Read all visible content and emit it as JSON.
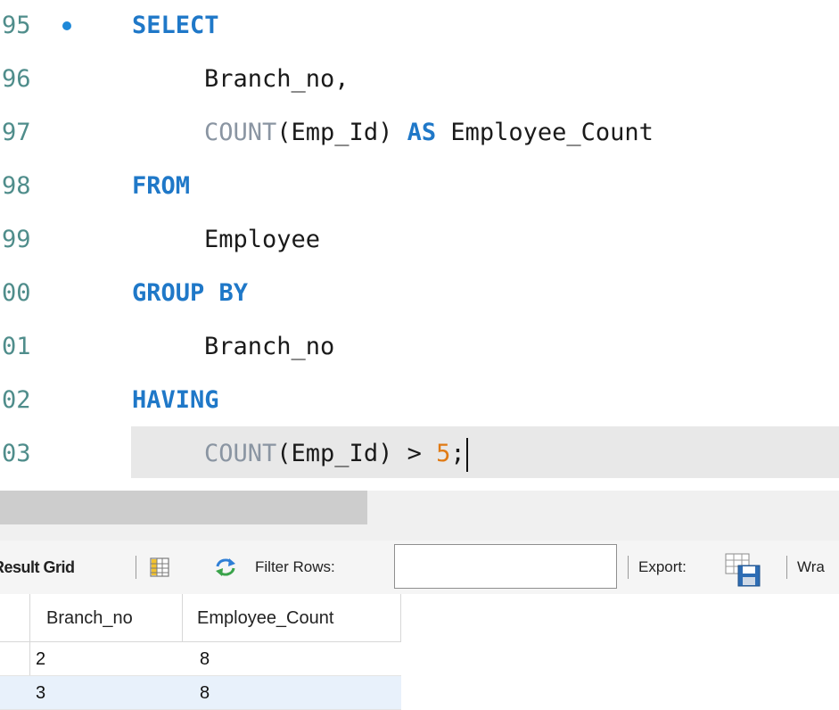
{
  "editor": {
    "lines": [
      {
        "ln": "95",
        "marker": true,
        "tokens": [
          {
            "t": "kw",
            "v": "SELECT"
          }
        ]
      },
      {
        "ln": "96",
        "marker": false,
        "tokens": [
          {
            "t": "pl",
            "v": "Branch_no,"
          }
        ]
      },
      {
        "ln": "97",
        "marker": false,
        "tokens": [
          {
            "t": "fn",
            "v": "COUNT"
          },
          {
            "t": "pl",
            "v": "(Emp_Id) "
          },
          {
            "t": "kw",
            "v": "AS"
          },
          {
            "t": "pl",
            "v": " Employee_Count"
          }
        ]
      },
      {
        "ln": "98",
        "marker": false,
        "tokens": [
          {
            "t": "kw",
            "v": "FROM"
          }
        ]
      },
      {
        "ln": "99",
        "marker": false,
        "tokens": [
          {
            "t": "pl",
            "v": "Employee"
          }
        ]
      },
      {
        "ln": "00",
        "marker": false,
        "tokens": [
          {
            "t": "kw",
            "v": "GROUP BY"
          }
        ]
      },
      {
        "ln": "01",
        "marker": false,
        "tokens": [
          {
            "t": "pl",
            "v": "Branch_no"
          }
        ]
      },
      {
        "ln": "02",
        "marker": false,
        "tokens": [
          {
            "t": "kw",
            "v": "HAVING"
          }
        ]
      },
      {
        "ln": "03",
        "marker": false,
        "tokens": [
          {
            "t": "fn",
            "v": "COUNT"
          },
          {
            "t": "pl",
            "v": "(Emp_Id) > "
          },
          {
            "t": "num",
            "v": "5"
          },
          {
            "t": "pl",
            "v": ";"
          }
        ],
        "current": true
      }
    ],
    "colors": {
      "line_number": "#4f8d8b",
      "keyword": "#1f78c8",
      "function": "#8a95a2",
      "number": "#e07a14",
      "text": "#1a1a1a",
      "current_line_bg": "#e8e8e8"
    }
  },
  "toolbar": {
    "result_grid_label": "Result Grid",
    "grid_icon": "form-grid-icon",
    "refresh_icon": "refresh-icon",
    "filter_label": "Filter Rows:",
    "filter_value": "",
    "export_label": "Export:",
    "export_icon": "export-save-icon",
    "wrap_label": "Wra"
  },
  "result_grid": {
    "columns": [
      "Branch_no",
      "Employee_Count"
    ],
    "rows": [
      {
        "Branch_no": "2",
        "Employee_Count": "8"
      },
      {
        "Branch_no": "3",
        "Employee_Count": "8"
      }
    ],
    "colors": {
      "alt_row": "#e8f1fb"
    }
  }
}
